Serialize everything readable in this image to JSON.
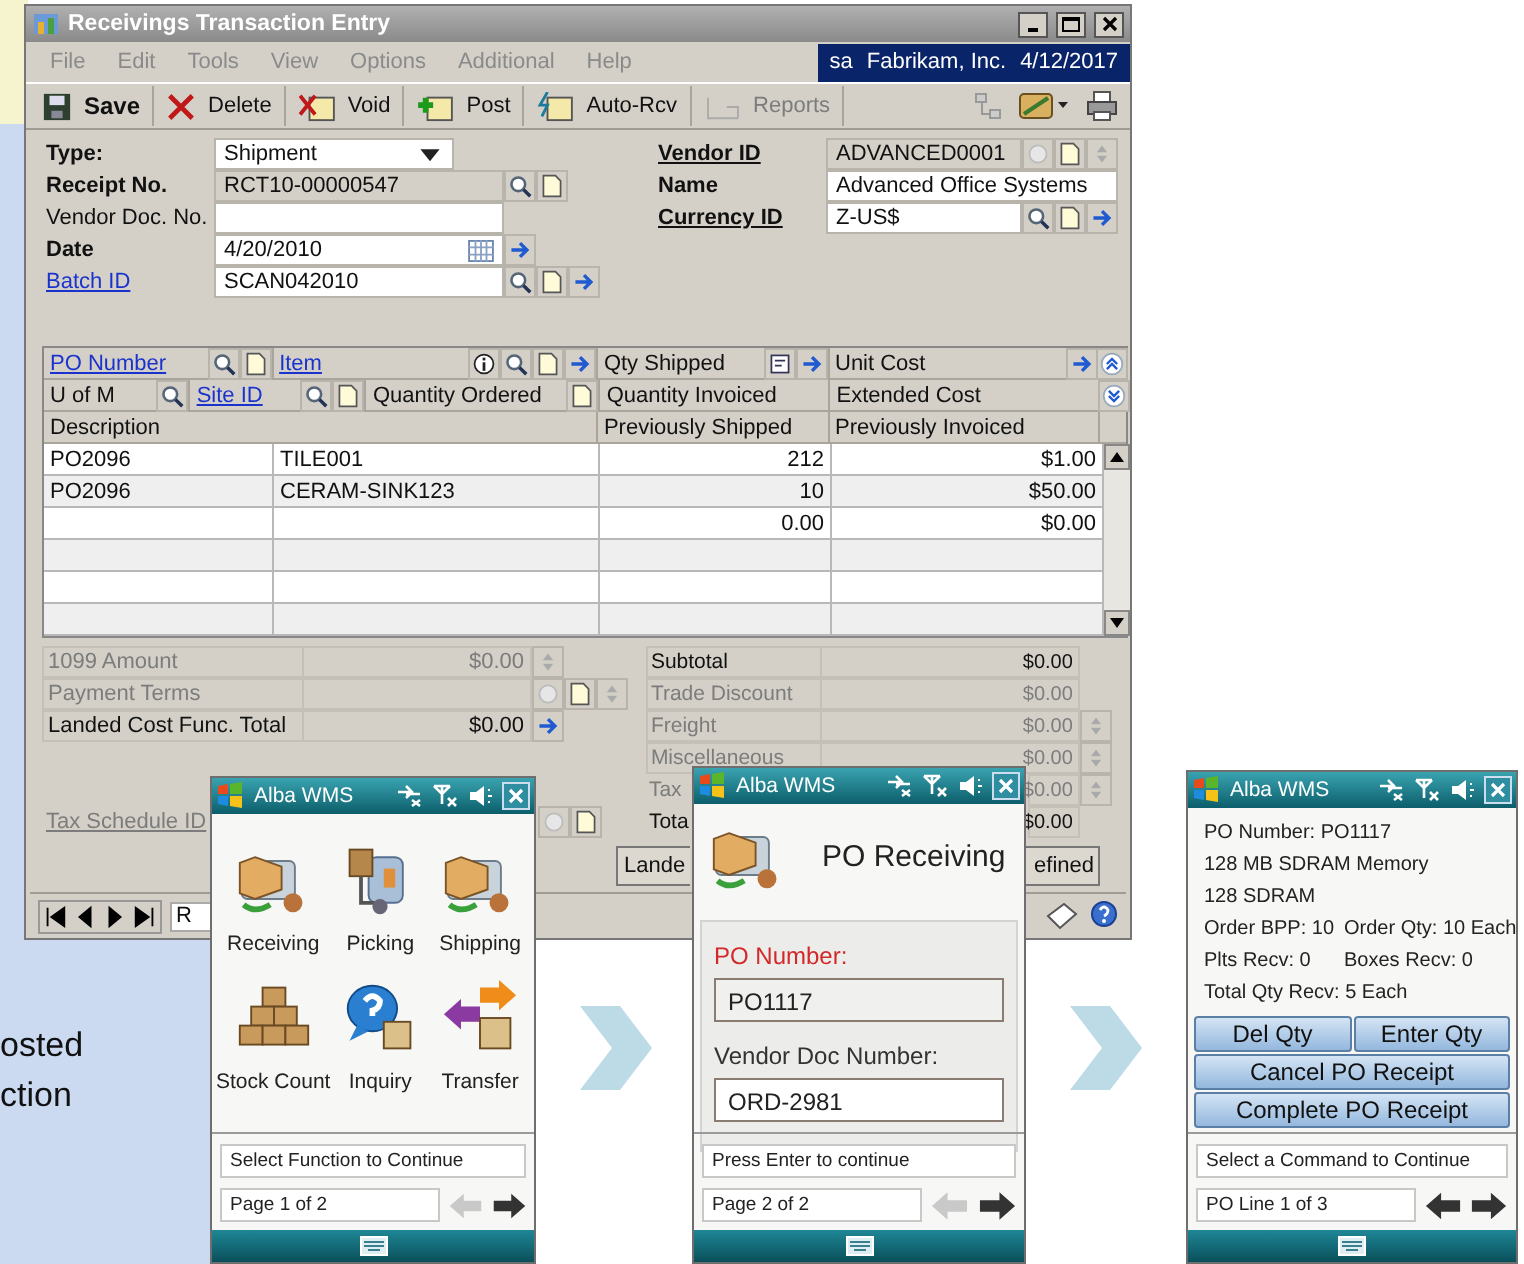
{
  "desktop_text": [
    "osted",
    "ction"
  ],
  "main_window": {
    "title": "Receivings Transaction Entry",
    "menu": [
      "File",
      "Edit",
      "Tools",
      "View",
      "Options",
      "Additional",
      "Help"
    ],
    "session": {
      "user": "sa",
      "company": "Fabrikam, Inc.",
      "date": "4/12/2017"
    },
    "toolbar": [
      {
        "kind": "save",
        "label": "Save",
        "disabled": false
      },
      {
        "kind": "delete",
        "label": "Delete",
        "disabled": false
      },
      {
        "kind": "void",
        "label": "Void",
        "disabled": false
      },
      {
        "kind": "post",
        "label": "Post",
        "disabled": false
      },
      {
        "kind": "auto",
        "label": "Auto-Rcv",
        "disabled": false
      },
      {
        "kind": "reports",
        "label": "Reports",
        "disabled": true
      }
    ],
    "header_left": [
      {
        "label": "Type:",
        "required": true,
        "link": false,
        "kind": "dropdown",
        "value": "Shipment",
        "readonly": false
      },
      {
        "label": "Receipt No.",
        "required": true,
        "link": false,
        "kind": "text",
        "value": "RCT10-00000547",
        "readonly": true
      },
      {
        "label": "Vendor Doc. No.",
        "required": false,
        "link": false,
        "kind": "text",
        "readonly": false
      },
      {
        "label": "Date",
        "required": true,
        "link": false,
        "kind": "date",
        "value": "4/20/2010",
        "readonly": false
      },
      {
        "label": "Batch ID",
        "required": false,
        "link": true,
        "kind": "text",
        "value": "SCAN042010",
        "readonly": false
      }
    ],
    "header_right": [
      {
        "label": "Vendor ID",
        "required": true,
        "link": true,
        "kind": "text",
        "value": "ADVANCED0001",
        "readonly": true
      },
      {
        "label": "Name",
        "required": true,
        "link": false,
        "kind": "text",
        "value": "Advanced Office Systems",
        "readonly": false
      },
      {
        "label": "Currency ID",
        "required": true,
        "link": true,
        "kind": "text",
        "value": "Z-US$",
        "readonly": false
      }
    ],
    "grid": {
      "header_rows": [
        {
          "cells": [
            {
              "text": "PO Number",
              "link": true
            },
            {
              "text": "Item",
              "link": true
            },
            {
              "text": "Qty Shipped",
              "link": false
            },
            {
              "text": "Unit Cost",
              "link": false
            }
          ]
        },
        {
          "cells": [
            {
              "text": "U of M",
              "link": false
            },
            {
              "text": "Site ID",
              "link": true
            },
            {
              "text": "Quantity Ordered",
              "link": false
            },
            {
              "text": "Quantity Invoiced",
              "link": false
            },
            {
              "text": "Extended Cost",
              "link": false
            }
          ]
        },
        {
          "cells": [
            {
              "text": "Description",
              "link": false
            },
            {
              "text": "Previously Shipped",
              "link": false
            },
            {
              "text": "Previously Invoiced",
              "link": false
            }
          ]
        }
      ],
      "rows": [
        {
          "po_number": "PO2096",
          "item": "TILE001",
          "qty_shipped": "212",
          "unit_cost": "$1.00"
        },
        {
          "po_number": "PO2096",
          "item": "CERAM-SINK123",
          "qty_shipped": "10",
          "unit_cost": "$50.00"
        },
        {
          "qty_shipped": "0.00",
          "unit_cost": "$0.00"
        }
      ]
    },
    "summary_left": [
      {
        "label": "1099 Amount",
        "value": "$0.00",
        "disabled": true
      },
      {
        "label": "Payment Terms",
        "disabled": true
      },
      {
        "label": "Landed Cost Func. Total",
        "value": "$0.00",
        "disabled": false
      }
    ],
    "tax_schedule": {
      "label": "Tax Schedule ID",
      "disabled": true
    },
    "totals": [
      {
        "label": "Subtotal",
        "value": "$0.00",
        "disabled": false
      },
      {
        "label": "Trade Discount",
        "value": "$0.00",
        "disabled": true
      },
      {
        "label": "Freight",
        "value": "$0.00",
        "disabled": true
      },
      {
        "label": "Miscellaneous",
        "value": "$0.00",
        "disabled": true
      },
      {
        "label": "Tax",
        "value": "$0.00",
        "disabled": true
      },
      {
        "label": "Tota",
        "value": "$0.00",
        "disabled": false
      }
    ],
    "buttons": [
      "Lande",
      "efined"
    ],
    "status_bar": {
      "record_field": "R"
    }
  },
  "devices": [
    {
      "kind": "menu",
      "title": "Alba WMS",
      "items": [
        {
          "kind": "receiving",
          "label": "Receiving"
        },
        {
          "kind": "picking",
          "label": "Picking"
        },
        {
          "kind": "shipping",
          "label": "Shipping"
        },
        {
          "kind": "stock",
          "label": "Stock Count"
        },
        {
          "kind": "inquiry",
          "label": "Inquiry"
        },
        {
          "kind": "transfer",
          "label": "Transfer"
        }
      ],
      "status": "Select Function to Continue",
      "page": "Page 1 of 2",
      "back_enabled": false,
      "forward_enabled": true
    },
    {
      "kind": "form",
      "title": "Alba WMS",
      "heading": "PO Receiving",
      "fields": [
        {
          "label": "PO Number:",
          "value": "PO1117",
          "active": true
        },
        {
          "label": "Vendor Doc Number:",
          "value": "ORD-2981",
          "active": false
        }
      ],
      "status": "Press Enter to continue",
      "page": "Page 2 of 2",
      "back_enabled": false,
      "forward_enabled": true
    },
    {
      "kind": "detail",
      "title": "Alba WMS",
      "lines": [
        [
          "PO Number: PO1117"
        ],
        [
          "128 MB SDRAM Memory"
        ],
        [
          "128 SDRAM"
        ],
        [
          "Order BPP: 10",
          "Order Qty: 10 Each"
        ],
        [
          "Plts Recv: 0",
          "Boxes Recv: 0"
        ],
        [
          "Total Qty Recv: 5 Each"
        ]
      ],
      "button_rows": [
        [
          "Del Qty",
          "Enter Qty"
        ],
        [
          "Cancel PO Receipt"
        ],
        [
          "Complete PO Receipt"
        ]
      ],
      "status": "Select a Command to Continue",
      "page": "PO Line 1 of 3",
      "back_enabled": true,
      "forward_enabled": true
    }
  ]
}
